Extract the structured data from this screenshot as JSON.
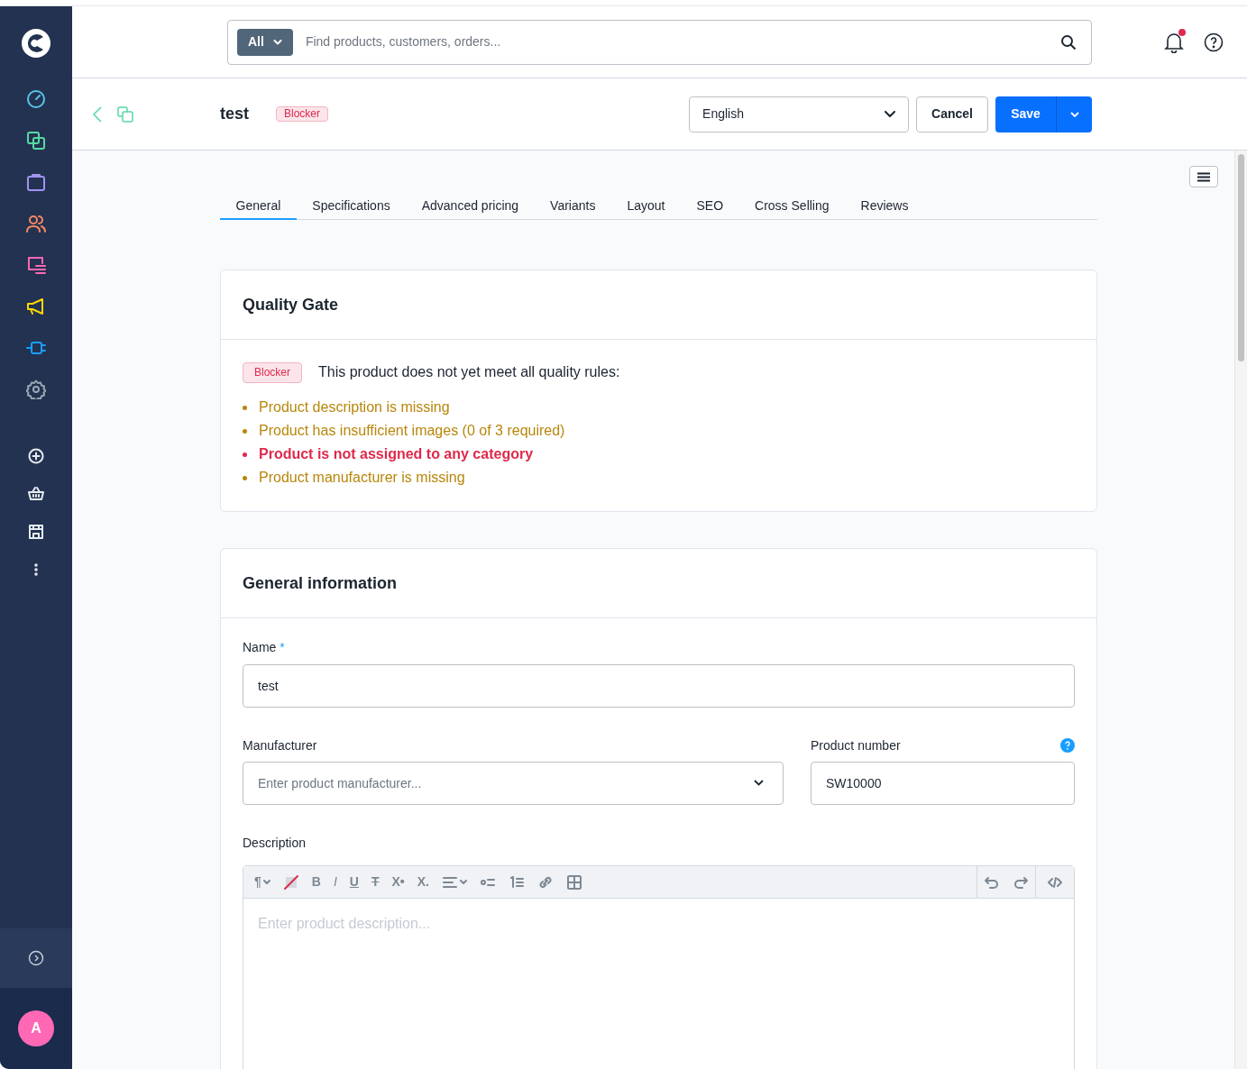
{
  "sidebar": {
    "items": [
      {
        "kind": "dashboard",
        "color": "#56c6e8"
      },
      {
        "kind": "catalog",
        "color": "#57d9a3"
      },
      {
        "kind": "orders",
        "color": "#a092f0"
      },
      {
        "kind": "customers",
        "color": "#f88962"
      },
      {
        "kind": "content",
        "color": "#ff68b4"
      },
      {
        "kind": "marketing",
        "color": "#ffd700"
      },
      {
        "kind": "extensions",
        "color": "#189eff"
      },
      {
        "kind": "settings",
        "color": "#9aa8b5"
      }
    ],
    "shortcuts": [
      {
        "kind": "add"
      },
      {
        "kind": "basket"
      },
      {
        "kind": "store"
      },
      {
        "kind": "more"
      }
    ],
    "avatar": "A"
  },
  "search": {
    "scope": "All",
    "placeholder": "Find products, customers, orders..."
  },
  "notifications": {
    "unread": true
  },
  "header": {
    "title": "test",
    "badge": "Blocker",
    "language": "English",
    "cancel": "Cancel",
    "save": "Save"
  },
  "tabs": [
    {
      "label": "General",
      "selected": true
    },
    {
      "label": "Specifications",
      "selected": false
    },
    {
      "label": "Advanced pricing",
      "selected": false
    },
    {
      "label": "Variants",
      "selected": false
    },
    {
      "label": "Layout",
      "selected": false
    },
    {
      "label": "SEO",
      "selected": false
    },
    {
      "label": "Cross Selling",
      "selected": false
    },
    {
      "label": "Reviews",
      "selected": false
    }
  ],
  "quality_gate": {
    "title": "Quality Gate",
    "badge": "Blocker",
    "message": "This product does not yet meet all quality rules:",
    "issues": [
      {
        "text": "Product description is missing",
        "kind": "warning"
      },
      {
        "text": "Product has insufficient images (0 of 3 required)",
        "kind": "warning"
      },
      {
        "text": "Product is not assigned to any category",
        "kind": "error"
      },
      {
        "text": "Product manufacturer is missing",
        "kind": "warning"
      }
    ]
  },
  "general_information": {
    "title": "General information",
    "name_label": "Name",
    "name_required": "*",
    "name_value": "test",
    "manufacturer_label": "Manufacturer",
    "manufacturer_placeholder": "Enter product manufacturer...",
    "product_number_label": "Product number",
    "product_number_value": "SW10000",
    "description_label": "Description",
    "description_placeholder": "Enter product description...",
    "toolbar": [
      {
        "kind": "text",
        "glyph": "¶",
        "caret": true
      },
      {
        "kind": "clear"
      },
      {
        "kind": "text",
        "glyph": "B"
      },
      {
        "kind": "text",
        "glyph": "I",
        "italic": true
      },
      {
        "kind": "text",
        "glyph": "U",
        "underline": true
      },
      {
        "kind": "text",
        "glyph": "T",
        "strike": true
      },
      {
        "kind": "text",
        "glyph": "X•"
      },
      {
        "kind": "text",
        "glyph": "X."
      },
      {
        "kind": "align",
        "caret": true
      },
      {
        "kind": "bullets"
      },
      {
        "kind": "numbers"
      },
      {
        "kind": "link"
      },
      {
        "kind": "table"
      }
    ],
    "toolbar_right": [
      {
        "kind": "undo"
      },
      {
        "kind": "redo"
      },
      {
        "kind": "code"
      }
    ]
  }
}
